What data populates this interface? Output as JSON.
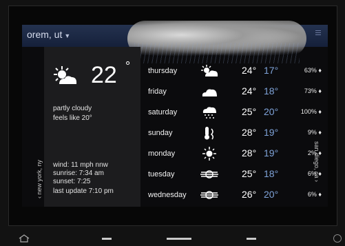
{
  "header": {
    "city": "orem, ut",
    "city_dropdown_icon": "chevron-down-icon",
    "menu_icon": "menu-icon"
  },
  "current": {
    "icon": "partly-cloudy-icon",
    "temp": "22",
    "deg_symbol": "°",
    "condition": "partly cloudy",
    "feels_like": "feels like 20°",
    "wind": "wind: 11 mph nnw",
    "sunrise": "sunrise: 7:34 am",
    "sunset": "sunset: 7:25",
    "last_update": "last update 7:10 pm"
  },
  "forecast": [
    {
      "day": "thursday",
      "icon": "partly-cloudy-icon",
      "hi": "24°",
      "lo": "17°",
      "precip": "63%"
    },
    {
      "day": "friday",
      "icon": "cloud-icon",
      "hi": "24°",
      "lo": "18°",
      "precip": "73%"
    },
    {
      "day": "saturday",
      "icon": "rain-icon",
      "hi": "25°",
      "lo": "20°",
      "precip": "100%"
    },
    {
      "day": "sunday",
      "icon": "thermometer-icon",
      "hi": "28°",
      "lo": "19°",
      "precip": "9%"
    },
    {
      "day": "monday",
      "icon": "sun-icon",
      "hi": "28°",
      "lo": "19°",
      "precip": "2%"
    },
    {
      "day": "tuesday",
      "icon": "haze-icon",
      "hi": "25°",
      "lo": "18°",
      "precip": "6%"
    },
    {
      "day": "wednesday",
      "icon": "haze-icon",
      "hi": "26°",
      "lo": "20°",
      "precip": "6%"
    }
  ],
  "nav": {
    "prev_city": "‹  new york, ny",
    "next_city": "san diego, ca  ›"
  },
  "system_bar": {
    "home_icon": "home-icon",
    "power_icon": "circle-icon"
  },
  "colors": {
    "low_temp": "#7fa3d9",
    "header_band": "#1d2945"
  }
}
